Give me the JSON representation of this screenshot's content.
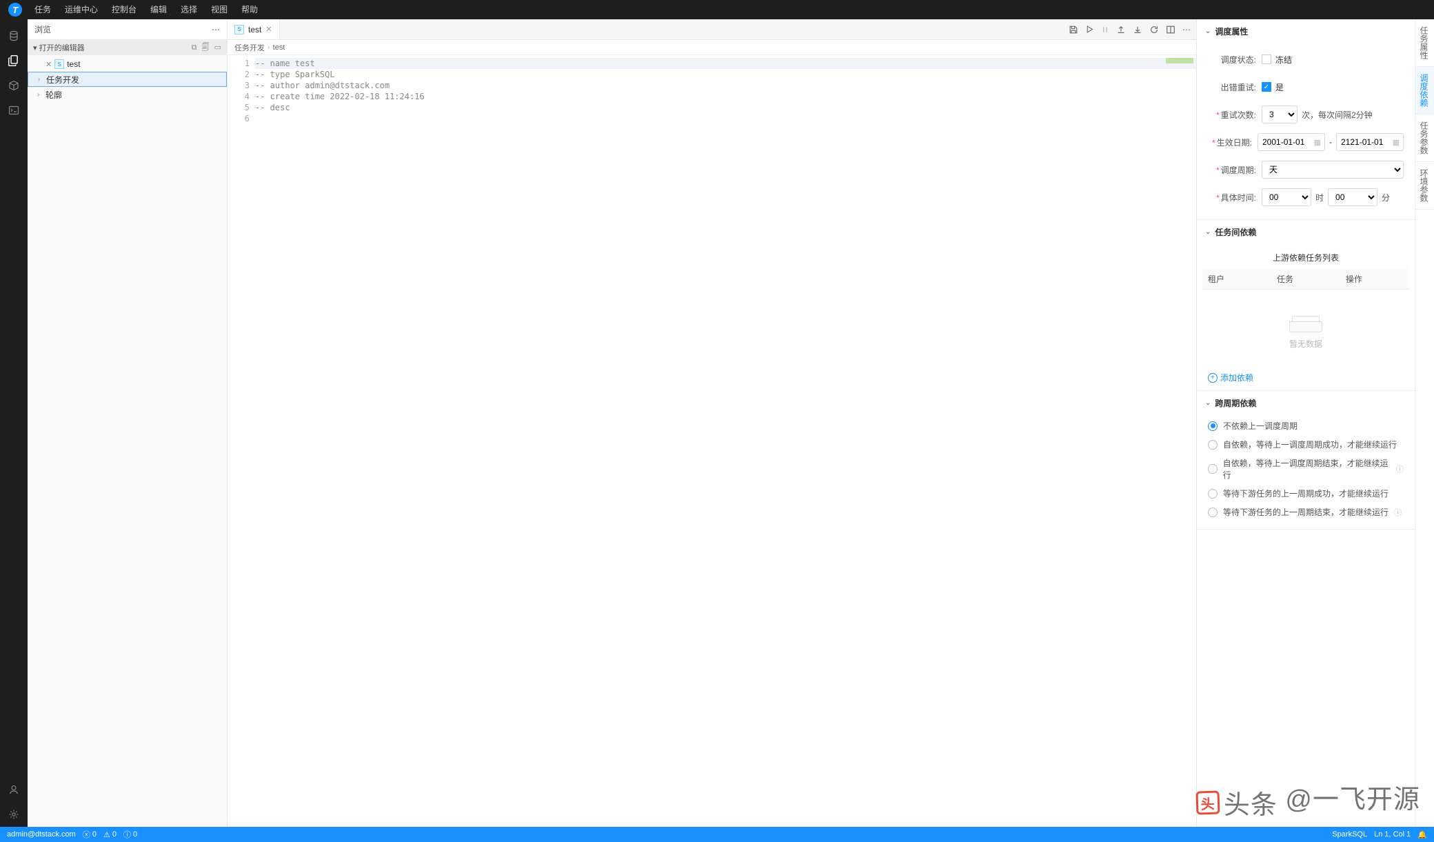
{
  "menubar": {
    "items": [
      "任务",
      "运维中心",
      "控制台",
      "编辑",
      "选择",
      "视图",
      "帮助"
    ]
  },
  "explorer": {
    "title": "浏览",
    "open_editors_label": "打开的编辑器",
    "items": [
      {
        "type": "file",
        "label": "test",
        "icon": "sql",
        "closeable": true
      },
      {
        "type": "folder",
        "label": "任务开发",
        "expanded": false,
        "selected": true
      },
      {
        "type": "folder",
        "label": "轮廓",
        "expanded": false
      }
    ]
  },
  "tabs": {
    "items": [
      {
        "label": "test",
        "icon": "sql"
      }
    ]
  },
  "breadcrumb": {
    "a": "任务开发",
    "b": "test"
  },
  "code": {
    "lines": [
      "-- name test",
      "-- type SparkSQL",
      "-- author admin@dtstack.com",
      "-- create time 2022-02-18 11:24:16",
      "-- desc",
      ""
    ]
  },
  "rightpanel": {
    "title": "调度属性",
    "side_tabs": [
      "任务属性",
      "调度依赖",
      "任务参数",
      "环境参数"
    ],
    "active_side_tab": 1,
    "schedule": {
      "status_label": "调度状态:",
      "status_option": "冻结",
      "retry_label": "出错重试:",
      "retry_option": "是",
      "retry_count_label": "重试次数:",
      "retry_count": "3",
      "retry_suffix": "次，每次间隔2分钟",
      "effective_label": "生效日期:",
      "date_from": "2001-01-01",
      "date_to": "2121-01-01",
      "cycle_label": "调度周期:",
      "cycle_value": "天",
      "time_label": "具体时间:",
      "hour": "00",
      "hour_suffix": "时",
      "minute": "00",
      "minute_suffix": "分"
    },
    "deps": {
      "title": "任务间依赖",
      "subtitle": "上游依赖任务列表",
      "cols": [
        "租户",
        "任务",
        "操作"
      ],
      "empty": "暂无数据",
      "add": "添加依赖"
    },
    "cross": {
      "title": "跨周期依赖",
      "options": [
        "不依赖上一调度周期",
        "自依赖，等待上一调度周期成功，才能继续运行",
        "自依赖，等待上一调度周期结束，才能继续运行",
        "等待下游任务的上一周期成功，才能继续运行",
        "等待下游任务的上一周期结束，才能继续运行"
      ],
      "selected": 0,
      "help_idx": [
        2,
        4
      ]
    }
  },
  "statusbar": {
    "user": "admin@dtstack.com",
    "err": "0",
    "warn": "0",
    "info": "0",
    "lang": "SparkSQL",
    "pos": "Ln 1, Col 1"
  },
  "watermark": {
    "brand": "头条",
    "text": "@一飞开源"
  }
}
